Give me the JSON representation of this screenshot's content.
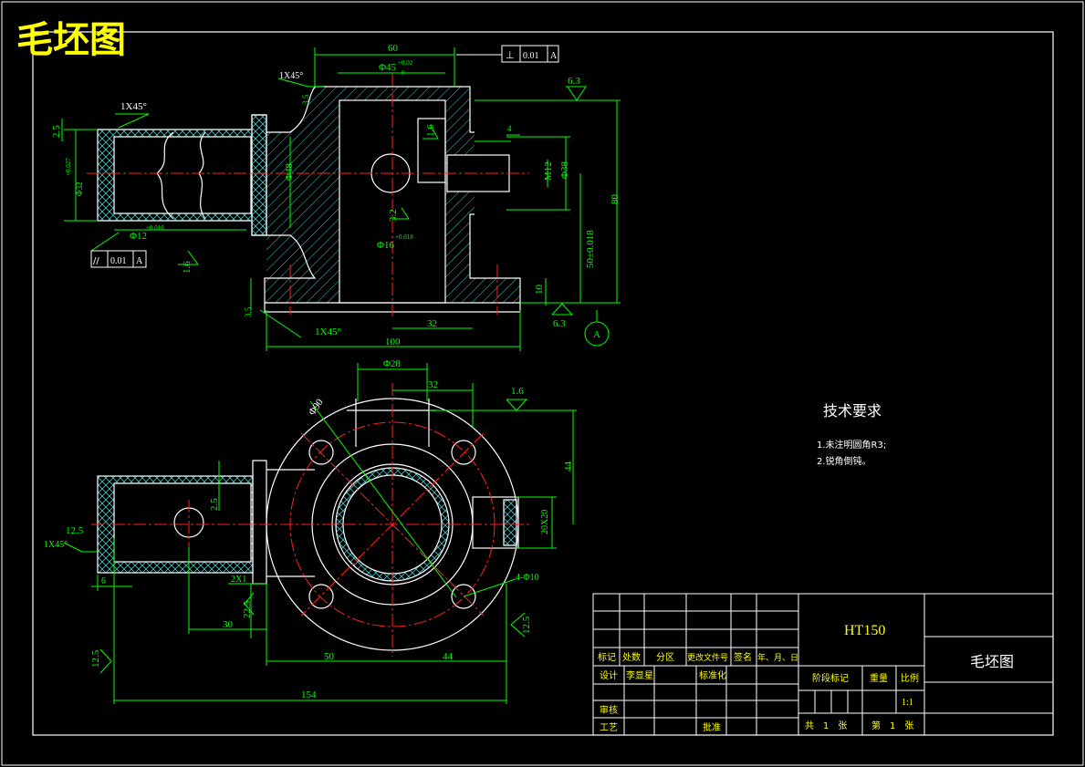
{
  "banner": {
    "title": "毛坯图"
  },
  "colors": {
    "background": "#000000",
    "outline": "#ffffff",
    "dimension": "#00ff00",
    "centerline": "#ff2020",
    "hatch": "#40c0c0",
    "banner": "#ffff00",
    "text": "#ffffff"
  },
  "top_view": {
    "dims": {
      "d60": "60",
      "d45": "Φ45",
      "d45_tol": "+0.02",
      "d45_tol_low": "0",
      "d1x45_top": "1X45°",
      "d3_5_top": "3.5",
      "d48": "Φ48",
      "d1_6_a": "1.6",
      "d3_2": "3.2",
      "d16": "Φ16",
      "d16_tol": "+0.018",
      "d4": "4",
      "dM12": "M12",
      "d38": "Φ38",
      "d80": "80",
      "d50": "50±0.018",
      "d10": "10",
      "d6_3_top": "6.3",
      "d6_3_bot": "6.3",
      "d3_5_bot": "3.5",
      "d1x45_bot": "1X45°",
      "d32": "32",
      "d100": "100",
      "d2_5": "2.5",
      "d1x45_left": "1X45°",
      "d32_left": "Φ32",
      "d32_left_tol": "+0.027",
      "d12": "Φ12",
      "d12_tol": "+0.018",
      "d1_6_b": "1.6"
    },
    "tol_frame_top": {
      "symbol": "⊥",
      "value": "0.01",
      "datum": "A"
    },
    "tol_frame_left": {
      "symbol": "//",
      "value": "0.01",
      "datum": "A"
    },
    "datum_label": "A"
  },
  "bottom_view": {
    "dims": {
      "d28": "Φ28",
      "d32": "32",
      "d1_6": "1.6",
      "d90": "Φ90",
      "d44_v": "44",
      "d20x20": "20X20",
      "d4xd10": "4-Φ10",
      "d12_5_left": "12.5",
      "d1x45": "1X45°",
      "d2_5": "2.5",
      "d6": "6",
      "d2x1": "2X1",
      "d30": "30",
      "d22_5": "22.5",
      "d50": "50",
      "d44_h": "44",
      "d12_5_bl": "12.5",
      "d12_5_br": "12.5",
      "d154": "154"
    }
  },
  "tech_req": {
    "title": "技术要求",
    "items": [
      "1.未注明圆角R3;",
      "2.锐角倒钝。"
    ]
  },
  "title_block": {
    "material": "HT150",
    "name": "毛坯图",
    "header": [
      "标记",
      "处数",
      "分区",
      "更改文件号",
      "签名",
      "年、月、日"
    ],
    "design_label": "设计",
    "designer": "李显星",
    "standard_label": "标准化",
    "review_label": "审核",
    "process_label": "工艺",
    "approve_label": "批准",
    "stage_label": "阶段标记",
    "weight_label": "重量",
    "scale_label": "比例",
    "scale_value": "1:1",
    "sheet_total": "共　1　张",
    "sheet_no": "第　1　张"
  }
}
